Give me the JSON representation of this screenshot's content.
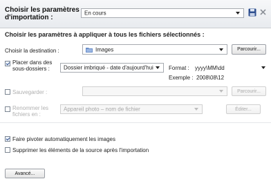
{
  "header": {
    "title_line1": "Choisir les paramètres",
    "title_line2": "d'importation :",
    "preset_value": "En cours"
  },
  "section": {
    "title": "Choisir les paramètres à appliquer à tous les fichiers sélectionnés :"
  },
  "destination": {
    "label": "Choisir la destination :",
    "value": "Images",
    "browse_label": "Parcourir..."
  },
  "subfolders": {
    "label_line1": "Placer dans des",
    "label_line2": "sous-dossiers :",
    "checked": true,
    "value": "Dossier imbriqué - date d'aujourd'hui",
    "format_label": "Format :",
    "format_value": "yyyy\\MM\\dd",
    "example_label": "Exemple :",
    "example_value": "2008\\08\\12"
  },
  "backup": {
    "label": "Sauvegarder :",
    "checked": false,
    "browse_label": "Parcourir..."
  },
  "rename": {
    "label_line1": "Renommer les",
    "label_line2": "fichiers en :",
    "checked": false,
    "value": "Appareil photo – nom de fichier",
    "edit_label": "Éditer..."
  },
  "options": {
    "rotate_label": "Faire pivoter automatiquement les images",
    "rotate_checked": true,
    "delete_label": "Supprimer les éléments de la source après l'importation",
    "delete_checked": false
  },
  "advanced_label": "Avancé..."
}
